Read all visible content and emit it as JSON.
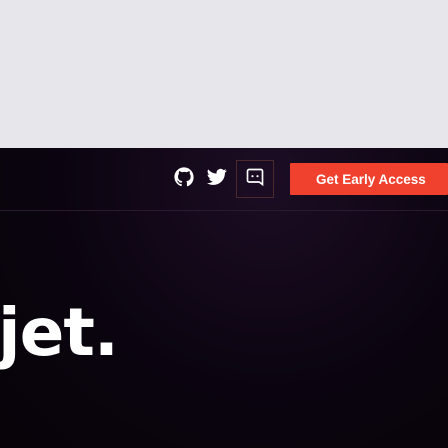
{
  "nav": {
    "social_icons": [
      "github-icon",
      "twitter-icon",
      "discord-icon"
    ],
    "cta_label": "Get Early Access"
  },
  "hero": {
    "headline_fragment": "jet."
  },
  "colors": {
    "top_band": "#e7e6ea",
    "background": "#0a0410",
    "accent": "#f0402e",
    "text": "#ffffff"
  }
}
